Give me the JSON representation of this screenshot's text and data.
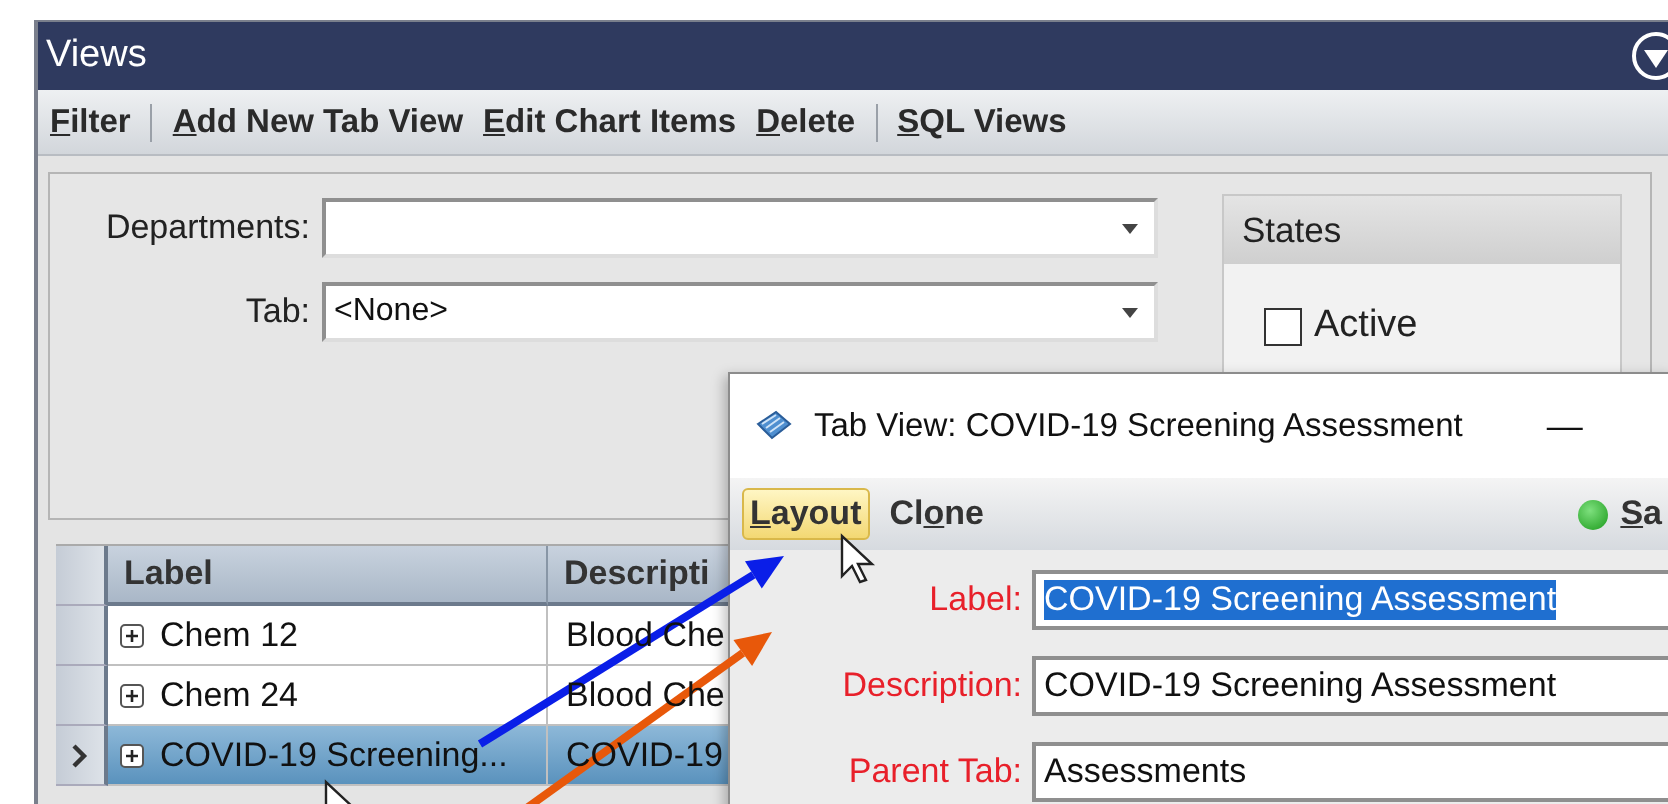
{
  "main_window": {
    "title": "Views",
    "toolbar": [
      {
        "items": [
          {
            "label": "Filter"
          }
        ]
      },
      {
        "items": [
          {
            "label": "Add New Tab View"
          },
          {
            "label": "Edit Chart Items"
          },
          {
            "label": "Delete"
          }
        ]
      },
      {
        "items": [
          {
            "label": "SQL Views"
          }
        ]
      }
    ],
    "filters": [
      {
        "label": "Departments:"
      },
      {
        "label": "Tab:",
        "value": "<None>"
      }
    ],
    "states": {
      "title": "States",
      "items": [
        {
          "label": "Active",
          "checked": false
        }
      ]
    },
    "table": {
      "columns": [
        "Label",
        "Descripti"
      ],
      "rows": [
        {
          "label": "Chem 12",
          "description": "Blood Che",
          "selected": false
        },
        {
          "label": "Chem 24",
          "description": "Blood Che",
          "selected": false
        },
        {
          "label": "COVID-19 Screening...",
          "description": "COVID-19",
          "selected": true
        }
      ]
    }
  },
  "dialog": {
    "title": "Tab View: COVID-19 Screening Assessment",
    "minimize": "—",
    "toolbar": [
      {
        "label": "Layout",
        "hovered": true
      },
      {
        "label": "Clone",
        "hovered": false
      }
    ],
    "status": {
      "label": "Sa"
    },
    "fields": [
      {
        "label": "Label:",
        "value": "COVID-19 Screening Assessment",
        "selected": true
      },
      {
        "label": "Description:",
        "value": "COVID-19 Screening Assessment",
        "selected": false
      },
      {
        "label": "Parent Tab:",
        "value": "Assessments",
        "selected": false
      }
    ]
  },
  "annotations": [
    {
      "kind": "arrow",
      "color": "#0a1ee8"
    },
    {
      "kind": "arrow",
      "color": "#e8580a"
    }
  ]
}
